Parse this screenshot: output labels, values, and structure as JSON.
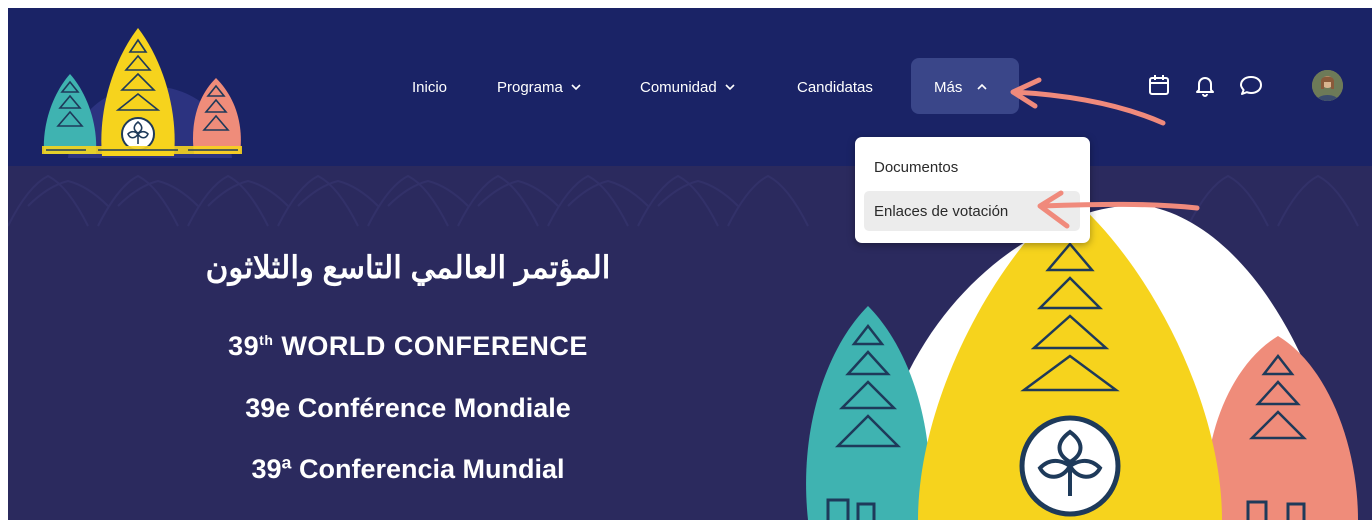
{
  "nav": {
    "items": [
      {
        "label": "Inicio",
        "has_chevron": false
      },
      {
        "label": "Programa",
        "has_chevron": true
      },
      {
        "label": "Comunidad",
        "has_chevron": true
      },
      {
        "label": "Candidatas",
        "has_chevron": false
      },
      {
        "label": "Más",
        "has_chevron": true,
        "active": true
      }
    ],
    "icons": [
      "calendar-icon",
      "bell-icon",
      "chat-bubble-icon",
      "avatar"
    ]
  },
  "dropdown": {
    "items": [
      {
        "label": "Documentos"
      },
      {
        "label": "Enlaces de votación",
        "highlighted": true
      }
    ]
  },
  "hero": {
    "title_arabic": "المؤتمر العالمي التاسع والثلاثون",
    "title_en_number": "39",
    "title_en_sup": "th",
    "title_en_text": " WORLD CONFERENCE",
    "title_fr": "39e Conférence Mondiale",
    "title_es": "39ª Conferencia Mundial"
  },
  "colors": {
    "navbar": "#1a2366",
    "hero_bg": "#2b2a5e",
    "active_pill": "#3a4689",
    "teal": "#3fb3b1",
    "yellow": "#f6d31d",
    "salmon": "#ef8c7a",
    "annotation_arrow": "#f08a7c"
  }
}
